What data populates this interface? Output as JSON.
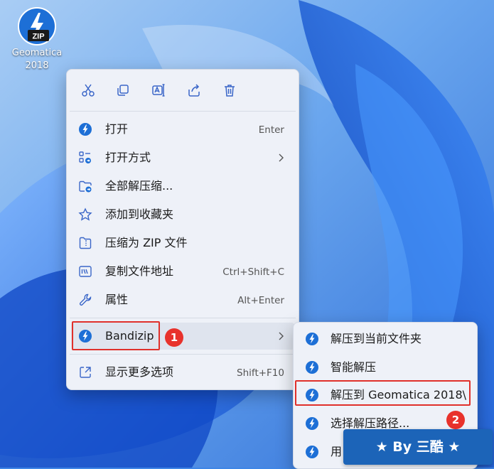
{
  "desktop": {
    "icon_badge": "ZIP",
    "icon_label_line1": "Geomatica",
    "icon_label_line2": "2018"
  },
  "toolbar": [
    "cut-icon",
    "copy-icon",
    "rename-icon",
    "share-icon",
    "delete-icon"
  ],
  "menu": {
    "items": [
      {
        "label": "打开",
        "shortcut": "Enter",
        "icon": "bandizip-icon"
      },
      {
        "label": "打开方式",
        "shortcut": "",
        "icon": "open-with-icon"
      },
      {
        "label": "全部解压缩...",
        "shortcut": "",
        "icon": "extract-folder-icon"
      },
      {
        "label": "添加到收藏夹",
        "shortcut": "",
        "icon": "star-icon"
      },
      {
        "label": "压缩为 ZIP 文件",
        "shortcut": "",
        "icon": "zip-file-icon"
      },
      {
        "label": "复制文件地址",
        "shortcut": "Ctrl+Shift+C",
        "icon": "copy-path-icon"
      },
      {
        "label": "属性",
        "shortcut": "Alt+Enter",
        "icon": "wrench-icon"
      },
      {
        "label": "Bandizip",
        "shortcut": "",
        "icon": "bandizip-icon"
      },
      {
        "label": "显示更多选项",
        "shortcut": "Shift+F10",
        "icon": "more-options-icon"
      }
    ]
  },
  "submenu": {
    "items": [
      {
        "label": "解压到当前文件夹"
      },
      {
        "label": "智能解压"
      },
      {
        "label": "解压到 Geomatica 2018\\"
      },
      {
        "label": "选择解压路径..."
      },
      {
        "label": "用"
      }
    ]
  },
  "badges": {
    "step1": "1",
    "step2": "2"
  },
  "watermark": {
    "text": "★ By 三酷 ★"
  },
  "colors": {
    "accent": "#1d6fd6",
    "highlight": "#e0302b",
    "watermark": "#1c64b8"
  }
}
